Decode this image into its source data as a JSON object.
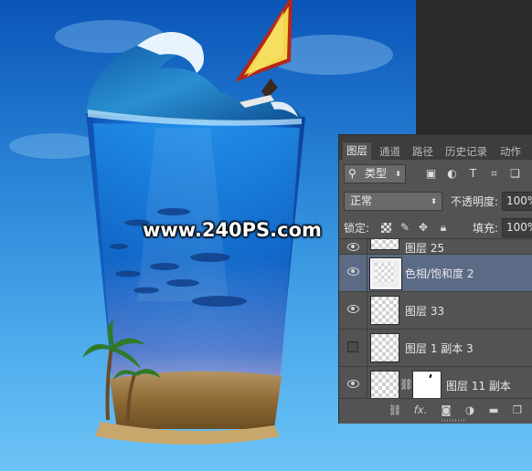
{
  "watermark": {
    "text": "www.240PS.com"
  },
  "layers_panel": {
    "tabs": [
      {
        "label": "图层",
        "active": true
      },
      {
        "label": "通道",
        "active": false
      },
      {
        "label": "路径",
        "active": false
      },
      {
        "label": "历史记录",
        "active": false
      },
      {
        "label": "动作",
        "active": false
      }
    ],
    "filter": {
      "kind_label": "类型",
      "icons": [
        "image-filter-icon",
        "adjustment-filter-icon",
        "type-filter-icon",
        "shape-filter-icon",
        "smart-object-filter-icon"
      ]
    },
    "blend_mode": "正常",
    "opacity_label": "不透明度:",
    "opacity_value": "100%",
    "lock_label": "锁定:",
    "fill_label": "填充:",
    "fill_value": "100%",
    "layers": [
      {
        "name": "图层 25",
        "visible": true,
        "type": "pixel",
        "selected": false
      },
      {
        "name": "色相/饱和度 2",
        "visible": true,
        "type": "adjustment",
        "selected": true
      },
      {
        "name": "图层 33",
        "visible": true,
        "type": "pixel",
        "selected": false
      },
      {
        "name": "图层 1 副本 3",
        "visible": false,
        "type": "pixel",
        "selected": false
      },
      {
        "name": "图层 11 副本",
        "visible": true,
        "type": "pixel-with-mask",
        "selected": false
      }
    ],
    "bottom_icons": [
      "link-layers-icon",
      "fx-icon",
      "add-mask-icon",
      "new-adjustment-icon",
      "new-group-icon",
      "new-layer-icon"
    ],
    "fx_label": "fx."
  }
}
